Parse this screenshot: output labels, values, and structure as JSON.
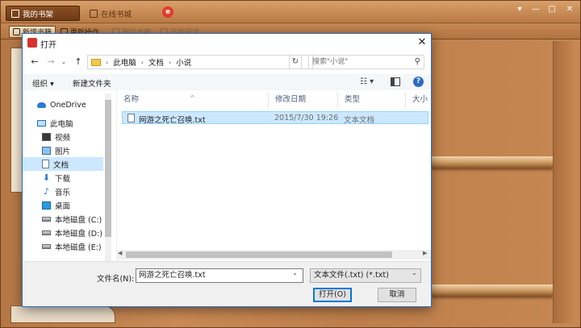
{
  "app": {
    "tabs": [
      "我的书架",
      "在线书城"
    ],
    "weibo_glyph": "e",
    "window_controls": [
      "▾",
      "—",
      "□",
      "✕"
    ],
    "toolbar": [
      "新增书籍",
      "更新操作",
      "删除书籍",
      "开始阅读"
    ]
  },
  "dialog": {
    "title": "打开",
    "close": "✕",
    "breadcrumb": [
      "此电脑",
      "文档",
      "小说"
    ],
    "search_placeholder": "搜索\"小说\"",
    "commands": {
      "organize": "组织 ▾",
      "new_folder": "新建文件夹"
    },
    "help": "?",
    "tree": [
      "OneDrive",
      "此电脑",
      "视频",
      "图片",
      "文档",
      "下载",
      "音乐",
      "桌面",
      "本地磁盘 (C:)",
      "本地磁盘 (D:)",
      "本地磁盘 (E:)"
    ],
    "selected_tree_item": "文档",
    "columns": [
      "名称",
      "修改日期",
      "类型",
      "大小"
    ],
    "files": [
      {
        "name": "网游之死亡召唤.txt",
        "modified": "2015/7/30 19:26",
        "type": "文本文档"
      }
    ],
    "filename_label": "文件名(N):",
    "filename_value": "网游之死亡召唤.txt",
    "filetype_value": "文本文件(.txt) (*.txt)",
    "open_button": "打开(O)",
    "cancel_button": "取消"
  },
  "colors": {
    "accent": "#0078d7",
    "selection": "#cce8ff",
    "dialog_border": "#2b6cc4"
  }
}
